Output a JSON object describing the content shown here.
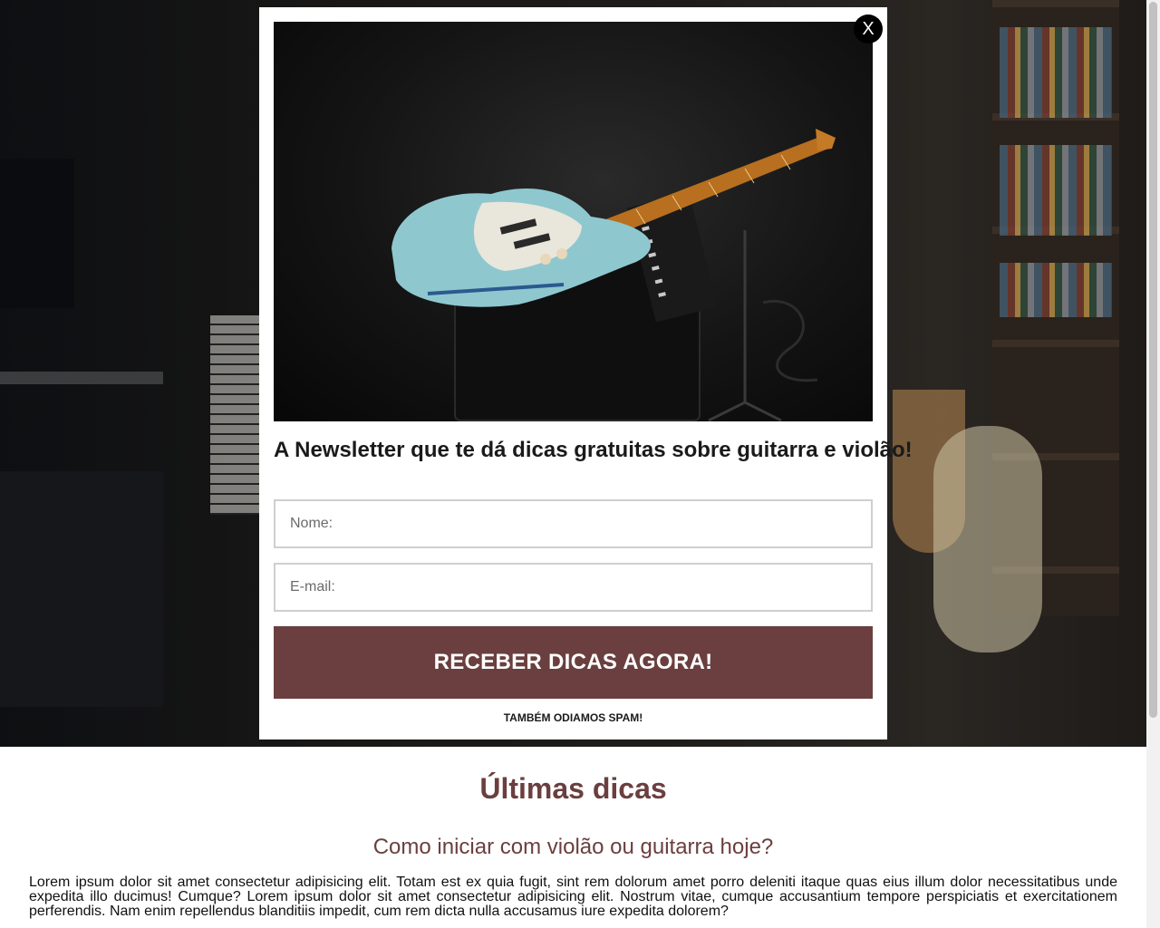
{
  "modal": {
    "close_label": "X",
    "title": "A Newsletter que te dá dicas gratuitas sobre guitarra e violão!",
    "name_placeholder": "Nome:",
    "email_placeholder": "E-mail:",
    "cta_label": "RECEBER DICAS AGORA!",
    "spam_note": "TAMBÉM ODIAMOS SPAM!",
    "image_icon": "electric-guitar-photo"
  },
  "content": {
    "section_title": "Últimas dicas",
    "post_title": "Como iniciar com violão ou guitarra hoje?",
    "post_body": "Lorem ipsum dolor sit amet consectetur adipisicing elit. Totam est ex quia fugit, sint rem dolorum amet porro deleniti itaque quas eius illum dolor necessitatibus unde expedita illo ducimus! Cumque? Lorem ipsum dolor sit amet consectetur adipisicing elit. Nostrum vitae, cumque accusantium tempore perspiciatis et exercitationem perferendis. Nam enim repellendus blanditiis impedit, cum rem dicta nulla accusamus iure expedita dolorem?"
  },
  "colors": {
    "brand": "#6b3f3f",
    "modal_background": "#ffffff",
    "close_button": "#000000"
  }
}
